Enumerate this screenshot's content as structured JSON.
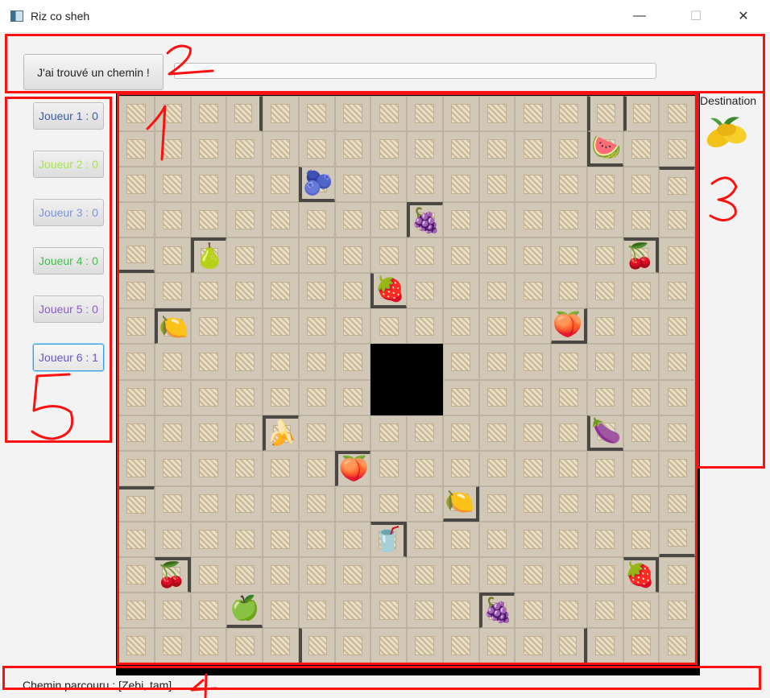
{
  "window": {
    "title": "Riz co sheh",
    "controls": {
      "minimize": "—",
      "maximize": "☐",
      "close": "✕"
    }
  },
  "toolbar": {
    "found_button": "J'ai trouvé un chemin !",
    "path_input_value": ""
  },
  "players": [
    {
      "label": "Joueur 1 : 0",
      "color": "#3b5fa3"
    },
    {
      "label": "Joueur 2 : 0",
      "color": "#a7e64a"
    },
    {
      "label": "Joueur 3 : 0",
      "color": "#7b92e0"
    },
    {
      "label": "Joueur 4 : 0",
      "color": "#3fc24a"
    },
    {
      "label": "Joueur 5 : 0",
      "color": "#8a5cc4"
    },
    {
      "label": "Joueur 6 : 1",
      "color": "#6a55c8"
    }
  ],
  "destination": {
    "label": "Destination",
    "fruit": "mango-icon"
  },
  "status": {
    "text": "Chemin parcouru : [Zebi, tam]"
  },
  "board": {
    "cols": 16,
    "rows": 16,
    "fruits": [
      {
        "r": 1,
        "c": 13,
        "glyph": "🍉",
        "name": "watermelon-icon"
      },
      {
        "r": 2,
        "c": 5,
        "glyph": "🫐",
        "name": "blueberry-icon"
      },
      {
        "r": 3,
        "c": 8,
        "glyph": "🍇",
        "name": "grapes-icon"
      },
      {
        "r": 4,
        "c": 2,
        "glyph": "🍐",
        "name": "pear-icon"
      },
      {
        "r": 4,
        "c": 14,
        "glyph": "🍒",
        "name": "redcurrant-icon"
      },
      {
        "r": 5,
        "c": 7,
        "glyph": "🍓",
        "name": "strawberry-icon"
      },
      {
        "r": 6,
        "c": 1,
        "glyph": "🍋",
        "name": "lemon-icon"
      },
      {
        "r": 6,
        "c": 12,
        "glyph": "🍑",
        "name": "apricot-icon"
      },
      {
        "r": 9,
        "c": 4,
        "glyph": "🍌",
        "name": "banana-icon"
      },
      {
        "r": 9,
        "c": 13,
        "glyph": "🍆",
        "name": "fig-icon"
      },
      {
        "r": 10,
        "c": 6,
        "glyph": "🍑",
        "name": "plum-icon"
      },
      {
        "r": 11,
        "c": 9,
        "glyph": "🍋",
        "name": "lemon-icon"
      },
      {
        "r": 12,
        "c": 7,
        "glyph": "🥤",
        "name": "smoothie-icon"
      },
      {
        "r": 13,
        "c": 1,
        "glyph": "🍒",
        "name": "cherry-icon"
      },
      {
        "r": 13,
        "c": 14,
        "glyph": "🍓",
        "name": "strawberry-icon"
      },
      {
        "r": 14,
        "c": 3,
        "glyph": "🍏",
        "name": "green-apple-icon"
      },
      {
        "r": 14,
        "c": 10,
        "glyph": "🍇",
        "name": "green-grapes-icon"
      }
    ]
  },
  "annotations": [
    "1",
    "2",
    "3",
    "4",
    "5"
  ],
  "colors": {
    "annotation": "#ff1010",
    "wall": "#4b4744",
    "tile": "#d2c8b8"
  }
}
